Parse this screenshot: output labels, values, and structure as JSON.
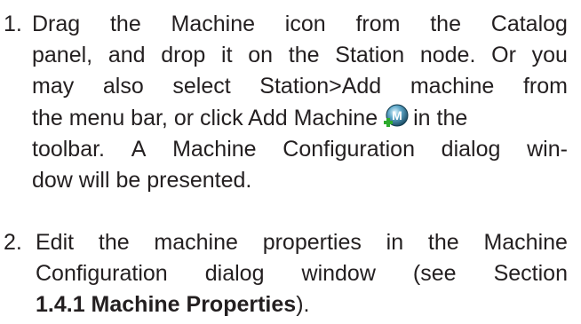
{
  "steps": [
    {
      "number": "1.",
      "lines": [
        [
          "Drag",
          "the",
          "Machine",
          "icon",
          "from",
          "the",
          "Catalog"
        ],
        [
          "panel,",
          "and",
          "drop",
          "it",
          "on",
          "the",
          "Station",
          "node.",
          "Or",
          "you"
        ],
        [
          "may",
          "also",
          "select",
          "Station>Add",
          "machine",
          "from"
        ],
        [
          "the menu bar, or click Add Machine",
          "in the"
        ],
        [
          "toolbar.",
          "A",
          "Machine",
          "Configuration",
          "dialog",
          "win-"
        ],
        [
          "dow will be presented."
        ]
      ],
      "icon": "add-machine-icon",
      "icon_letter": "M"
    },
    {
      "number": "2.",
      "lines": [
        [
          "Edit",
          "the",
          "machine",
          "properties",
          "in",
          "the",
          "Machine"
        ],
        [
          "Configuration",
          "dialog",
          "window",
          "(see",
          "Section"
        ]
      ],
      "last_line_bold": "1.4.1 Machine Properties",
      "last_line_tail": ")."
    }
  ]
}
